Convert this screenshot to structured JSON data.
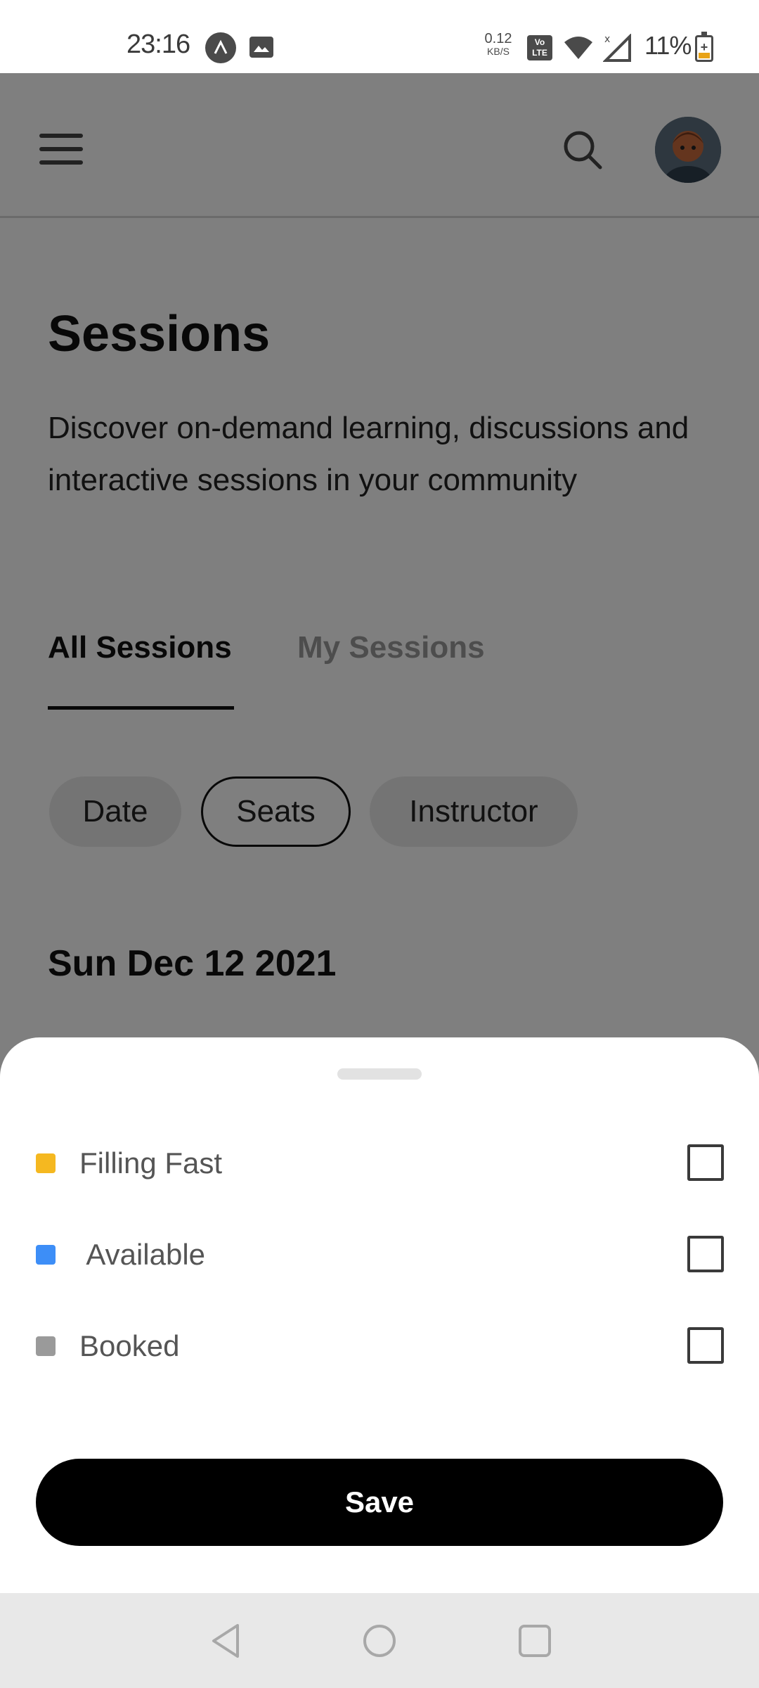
{
  "status_bar": {
    "time": "23:16",
    "net_speed_value": "0.12",
    "net_speed_unit": "KB/S",
    "volte_line1": "Vo",
    "volte_line2": "LTE",
    "battery_percent": "11%",
    "battery_color": "#e8a317",
    "icons": [
      "app-notification-icon",
      "gallery-icon",
      "volte-icon",
      "wifi-icon",
      "signal-icon",
      "battery-icon"
    ]
  },
  "header": {
    "menu_icon": "hamburger-menu-icon",
    "search_icon": "search-icon",
    "avatar_icon": "user-avatar"
  },
  "page": {
    "title": "Sessions",
    "description": "Discover on-demand learning, discussions and interactive sessions in your community"
  },
  "tabs": [
    {
      "label": "All Sessions",
      "active": true
    },
    {
      "label": "My Sessions",
      "active": false
    }
  ],
  "filters": [
    {
      "label": "Date",
      "selected": false
    },
    {
      "label": "Seats",
      "selected": true
    },
    {
      "label": "Instructor",
      "selected": false
    }
  ],
  "section": {
    "date_heading": "Sun Dec 12 2021"
  },
  "sheet": {
    "options": [
      {
        "label": "Filling Fast",
        "color": "#f5b820",
        "checked": false
      },
      {
        "label": " Available",
        "color": "#3d8ef7",
        "checked": false
      },
      {
        "label": "Booked",
        "color": "#9a9a9a",
        "checked": false
      }
    ],
    "save_label": "Save"
  },
  "nav_bar": {
    "icons": [
      "back-icon",
      "home-icon",
      "recents-icon"
    ]
  }
}
